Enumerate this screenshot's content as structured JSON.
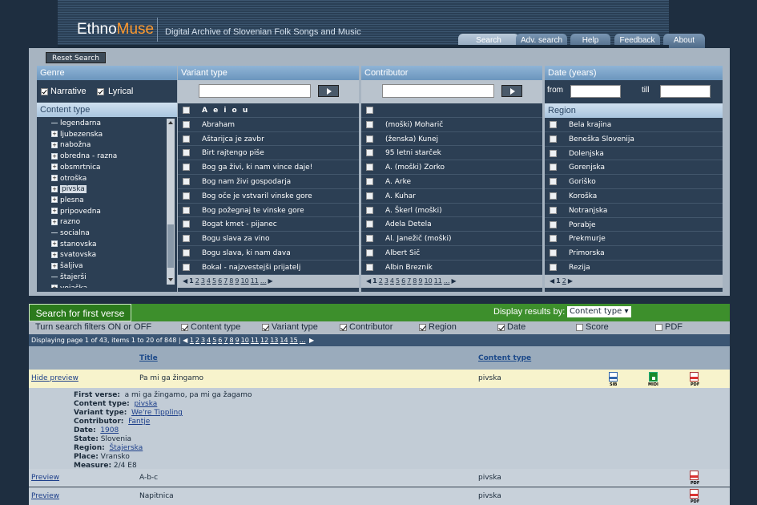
{
  "header": {
    "logo_main": "Ethno",
    "logo_accent": "Muse",
    "tagline": "Digital Archive of Slovenian Folk Songs and Music",
    "tabs": [
      "Search",
      "Adv. search",
      "Help",
      "Feedback",
      "About"
    ]
  },
  "search_panel": {
    "reset_label": "Reset Search",
    "genre": {
      "header": "Genre",
      "narrative_label": "Narrative",
      "lyrical_label": "Lyrical",
      "narrative_checked": true,
      "lyrical_checked": true
    },
    "content_type": {
      "header": "Content type",
      "items": [
        {
          "label": "legendarna",
          "expandable": false
        },
        {
          "label": "ljubezenska",
          "expandable": true
        },
        {
          "label": "nabožna",
          "expandable": true
        },
        {
          "label": "obredna - razna",
          "expandable": true
        },
        {
          "label": "obsmrtnica",
          "expandable": true
        },
        {
          "label": "otroška",
          "expandable": true
        },
        {
          "label": "pivska",
          "expandable": true,
          "selected": true
        },
        {
          "label": "plesna",
          "expandable": true
        },
        {
          "label": "pripovedna",
          "expandable": true
        },
        {
          "label": "razno",
          "expandable": true
        },
        {
          "label": "socialna",
          "expandable": false
        },
        {
          "label": "stanovska",
          "expandable": true
        },
        {
          "label": "svatovska",
          "expandable": true
        },
        {
          "label": "šaljiva",
          "expandable": true
        },
        {
          "label": "štajerši",
          "expandable": false
        },
        {
          "label": "vojaška",
          "expandable": true
        }
      ]
    },
    "variant_type": {
      "header": "Variant type",
      "input_value": "",
      "items": [
        "A e i o u",
        "Abraham",
        "Aštarijca je zavbr",
        "Birt rajtengo piše",
        "Bog ga živi, ki nam vince daje!",
        "Bog nam živi gospodarja",
        "Bog oče je vstvaril vinske gore",
        "Bog požegnaj te vinske gore",
        "Bogat kmet - pijanec",
        "Bogu slava za vino",
        "Bogu slava, ki nam dava",
        "Bokal - najzvestejši prijatelj"
      ],
      "pager": [
        "1",
        "2",
        "3",
        "4",
        "5",
        "6",
        "7",
        "8",
        "9",
        "10",
        "11",
        "..."
      ]
    },
    "contributor": {
      "header": "Contributor",
      "input_value": "",
      "items": [
        "",
        "(moški) Moharič",
        "(ženska) Kunej",
        "95 letni starček",
        "A. (moški) Zorko",
        "A. Arke",
        "A. Kuhar",
        "A. Škerl (moški)",
        "Adela Detela",
        "Al. Janežič (moški)",
        "Albert Sič",
        "Albin Breznik"
      ],
      "pager": [
        "1",
        "2",
        "3",
        "4",
        "5",
        "6",
        "7",
        "8",
        "9",
        "10",
        "11",
        "..."
      ]
    },
    "date": {
      "header": "Date (years)",
      "from_label": "from",
      "till_label": "till",
      "from_value": "",
      "till_value": ""
    },
    "region": {
      "header": "Region",
      "items": [
        "Bela krajina",
        "Beneška Slovenija",
        "Dolenjska",
        "Gorenjska",
        "Goriško",
        "Koroška",
        "Notranjska",
        "Porabje",
        "Prekmurje",
        "Primorska",
        "Rezija"
      ],
      "pager": [
        "1",
        "2"
      ]
    }
  },
  "results": {
    "search_first_label": "Search for first verse",
    "display_by_label": "Display results by:",
    "display_by_value": "Content type",
    "filters_label": "Turn search filters ON or OFF",
    "filters": [
      {
        "label": "Content type",
        "checked": true
      },
      {
        "label": "Variant type",
        "checked": true
      },
      {
        "label": "Contributor",
        "checked": true
      },
      {
        "label": "Region",
        "checked": true
      },
      {
        "label": "Date",
        "checked": true
      },
      {
        "label": "Score",
        "checked": false
      },
      {
        "label": "PDF",
        "checked": false
      }
    ],
    "paging_text": "Displaying page 1 of 43, items 1 to 20 of 848 |",
    "pages": [
      "1",
      "2",
      "3",
      "4",
      "5",
      "6",
      "7",
      "8",
      "9",
      "10",
      "11",
      "12",
      "13",
      "14",
      "15",
      "..."
    ],
    "columns": {
      "title": "Title",
      "content_type": "Content type"
    },
    "rows": [
      {
        "action": "Hide preview",
        "title": "Pa mi ga žingamo",
        "content_type": "pivska",
        "files": [
          "SIB",
          "MIDI",
          "PDF"
        ]
      },
      {
        "action": "Preview",
        "title": "A-b-c",
        "content_type": "pivska",
        "files": [
          "PDF"
        ]
      },
      {
        "action": "Preview",
        "title": "Napitnica",
        "content_type": "pivska",
        "files": [
          "PDF"
        ]
      }
    ],
    "details": {
      "first_verse_label": "First verse:",
      "first_verse": "a mi ga žingamo, pa mi ga žagamo",
      "content_type_label": "Content type:",
      "content_type": "pivska",
      "variant_type_label": "Variant type:",
      "variant_type": "We're Tippling",
      "contributor_label": "Contributor:",
      "contributor": "Fantje",
      "date_label": "Date:",
      "date": "1908",
      "state_label": "State:",
      "state": "Slovenia",
      "region_label": "Region:",
      "region": "Štajerska",
      "place_label": "Place:",
      "place": "Vransko",
      "measure_label": "Measure:",
      "measure": "2/4 E8"
    }
  }
}
